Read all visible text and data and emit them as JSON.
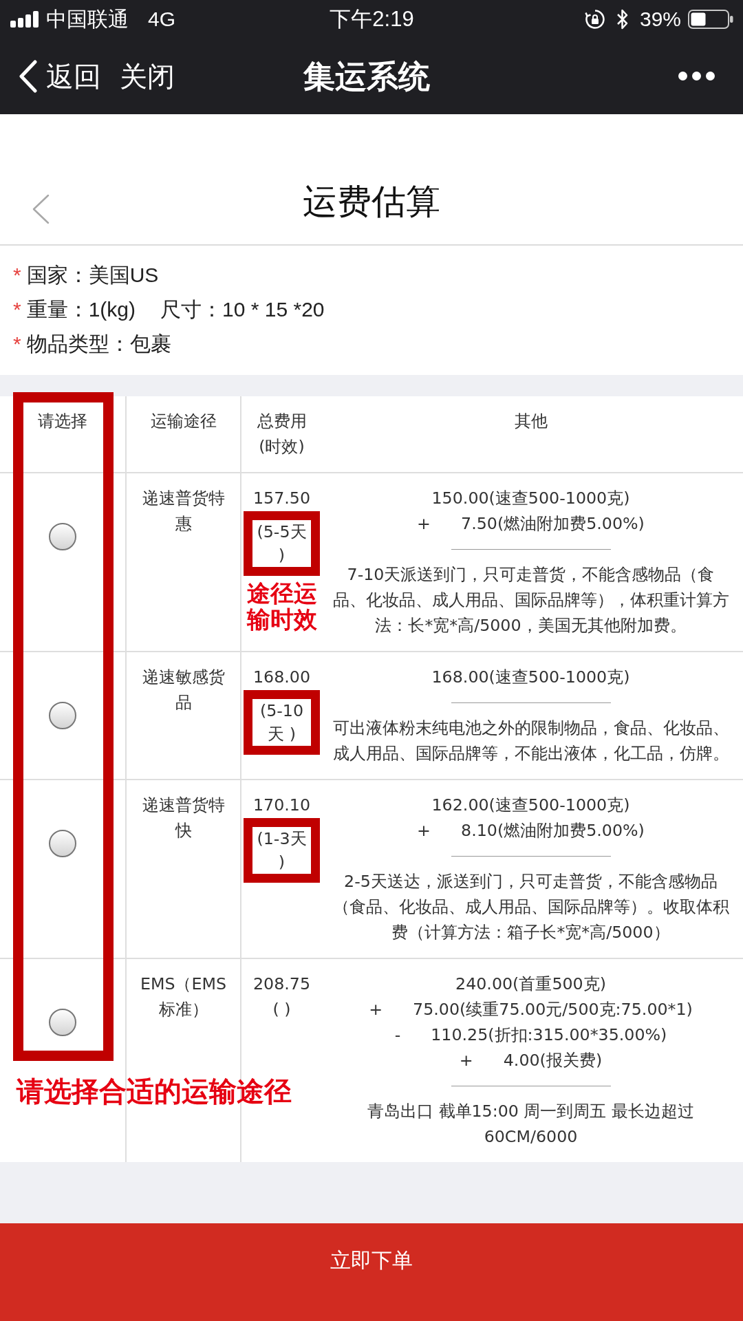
{
  "status_bar": {
    "carrier": "中国联通",
    "network": "4G",
    "time": "下午2:19",
    "battery": "39%"
  },
  "nav_bar": {
    "back": "返回",
    "close": "关闭",
    "title": "集运系统"
  },
  "page": {
    "title": "运费估算"
  },
  "summary": [
    {
      "mark": "*",
      "parts": [
        "国家：美国US"
      ]
    },
    {
      "mark": "*",
      "parts": [
        "重量：1(kg)",
        "尺寸：10 * 15 *20"
      ]
    },
    {
      "mark": "*",
      "parts": [
        "物品类型：包裹"
      ]
    }
  ],
  "table": {
    "columns": [
      "请选择",
      "运输途径",
      "总费用(时效)",
      "其他"
    ],
    "select_highlighted": true,
    "select_note": "请选择合适的运输途径",
    "rows": [
      {
        "selected": false,
        "route": "递速普货特惠",
        "total": "157.50",
        "time": "(5-5天 )",
        "time_highlighted": true,
        "time_note": "途径运输时效",
        "charges": [
          {
            "amount": "150.00(速查500-1000克)"
          },
          {
            "op": "+",
            "amount": "7.50(燃油附加费5.00%)"
          }
        ],
        "remark": "7-10天派送到门，只可走普货，不能含感物品（食品、化妆品、成人用品、国际品牌等），体积重计算方法：长*宽*高/5000，美国无其他附加费。"
      },
      {
        "selected": false,
        "route": "递速敏感货品",
        "total": "168.00",
        "time": "(5-10天 )",
        "time_highlighted": true,
        "charges": [
          {
            "amount": "168.00(速查500-1000克)"
          }
        ],
        "remark": "可出液体粉末纯电池之外的限制物品，食品、化妆品、成人用品、国际品牌等，不能出液体，化工品，仿牌。"
      },
      {
        "selected": false,
        "route": "递速普货特快",
        "total": "170.10",
        "time": "(1-3天 )",
        "time_highlighted": true,
        "charges": [
          {
            "amount": "162.00(速查500-1000克)"
          },
          {
            "op": "+",
            "amount": "8.10(燃油附加费5.00%)"
          }
        ],
        "remark": "2-5天送达，派送到门，只可走普货，不能含感物品（食品、化妆品、成人用品、国际品牌等）。收取体积费（计算方法：箱子长*宽*高/5000）"
      },
      {
        "selected": false,
        "route": "EMS（EMS标准）",
        "total": "208.75",
        "time": "( )",
        "time_highlighted": false,
        "charges": [
          {
            "amount": "240.00(首重500克)"
          },
          {
            "op": "+",
            "amount": "75.00(续重75.00元/500克:75.00*1)"
          },
          {
            "op": "-",
            "amount": "110.25(折扣:315.00*35.00%)"
          },
          {
            "op": "+",
            "amount": "4.00(报关费)"
          }
        ],
        "remark": "青岛出口 截单15:00 周一到周五 最长边超过 60CM/6000"
      }
    ]
  },
  "footer": {
    "button": "立即下单"
  }
}
